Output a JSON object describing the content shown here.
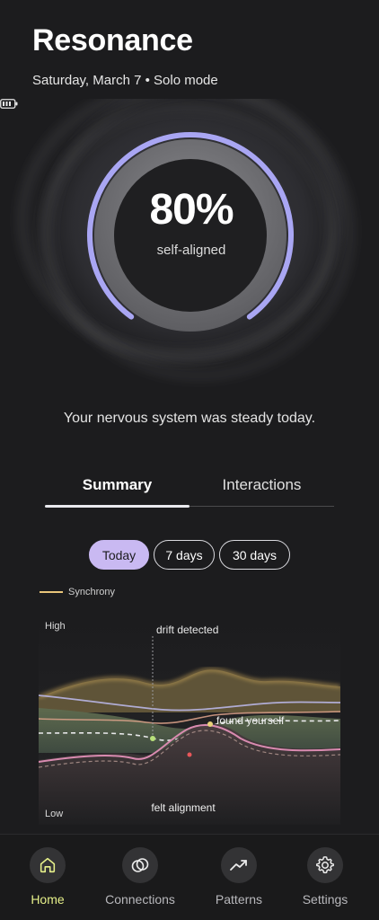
{
  "header": {
    "title": "Resonance",
    "subtitle": "Saturday, March 7 • Solo mode"
  },
  "score": {
    "value": "80%",
    "label": "self-aligned",
    "fraction": 0.8,
    "accent": "#a9a6f3",
    "battery_icon": "battery-icon"
  },
  "summary_text": "Your nervous system was steady today.",
  "tabs": [
    {
      "label": "Summary",
      "active": true
    },
    {
      "label": "Interactions",
      "active": false
    }
  ],
  "ranges": [
    {
      "label": "Today",
      "active": true
    },
    {
      "label": "7 days",
      "active": false
    },
    {
      "label": "30 days",
      "active": false
    }
  ],
  "chart": {
    "legend": "Synchrony",
    "legend_color": "#e9c57a",
    "high_label": "High",
    "low_label": "Low",
    "annotations": {
      "drift": "drift detected",
      "found": "found yourself",
      "felt": "felt alignment"
    }
  },
  "nav": [
    {
      "label": "Home",
      "icon": "home-icon",
      "active": true,
      "color": "#e6f08a"
    },
    {
      "label": "Connections",
      "icon": "connections-icon",
      "active": false
    },
    {
      "label": "Patterns",
      "icon": "trend-icon",
      "active": false
    },
    {
      "label": "Settings",
      "icon": "gear-icon",
      "active": false
    }
  ]
}
